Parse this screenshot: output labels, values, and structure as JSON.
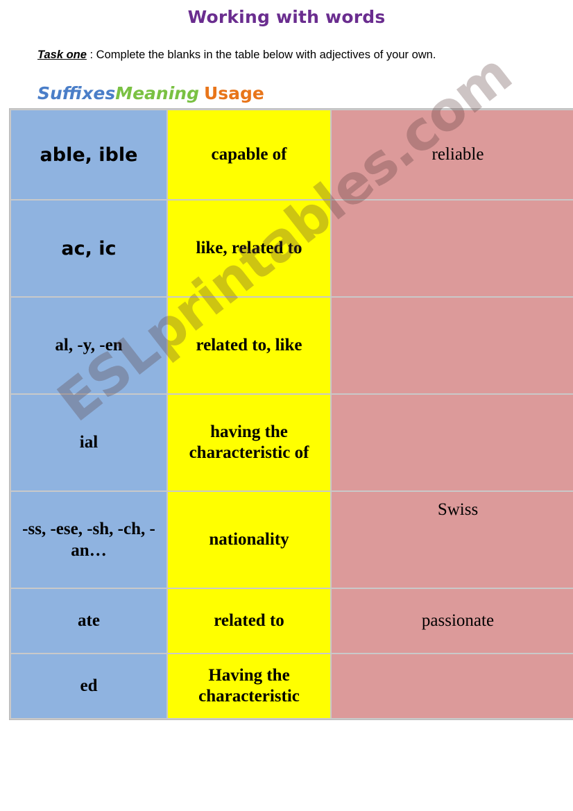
{
  "title": "Working with words",
  "task": {
    "label": "Task one",
    "text": " : Complete the blanks in the table below with adjectives of your own."
  },
  "headings": {
    "suffixes": "Suffixes",
    "meaning": "Meaning",
    "usage": "Usage"
  },
  "colors": {
    "title": "#6a2d8f",
    "suffixes_heading": "#4a7ec8",
    "meaning_heading": "#7ac143",
    "usage_heading": "#e8751a",
    "suffix_cell_bg": "#8fb3e0",
    "meaning_cell_bg": "#ffff00",
    "usage_cell_bg": "#dc9a9a"
  },
  "table": {
    "rows": [
      {
        "suffix": "able, ible",
        "meaning": "capable of",
        "usage": "reliable"
      },
      {
        "suffix": "ac, ic",
        "meaning": "like, related to",
        "usage": ""
      },
      {
        "suffix": "al, -y, -en",
        "meaning": "related to, like",
        "usage": ""
      },
      {
        "suffix": "ial",
        "meaning": "having the characteristic of",
        "usage": ""
      },
      {
        "suffix": "-ss, -ese, -sh, -ch, -an…",
        "meaning": "nationality",
        "usage": "Swiss"
      },
      {
        "suffix": "ate",
        "meaning": "related to",
        "usage": "passionate"
      },
      {
        "suffix": "ed",
        "meaning": "Having the characteristic",
        "usage": ""
      }
    ]
  },
  "watermark": "ESLprintables.com"
}
